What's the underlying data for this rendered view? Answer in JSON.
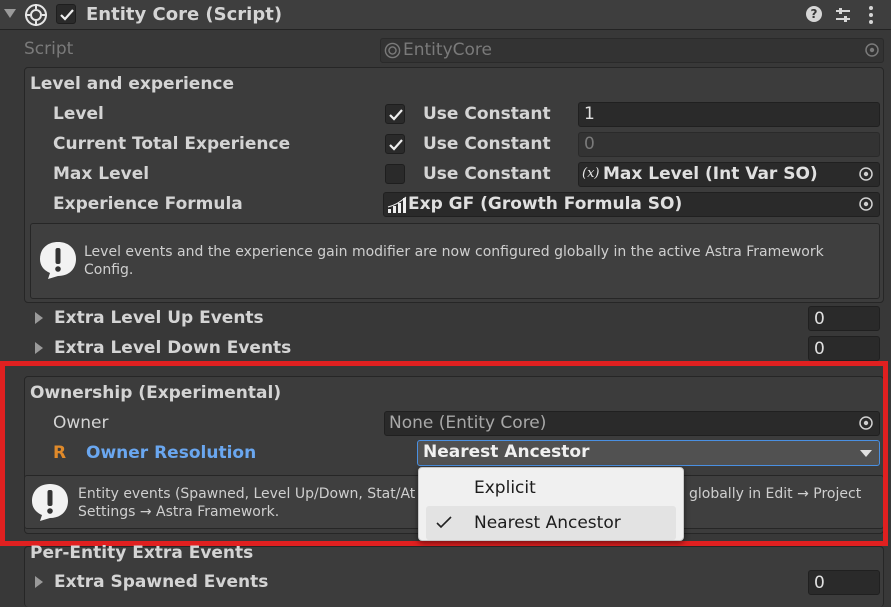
{
  "header": {
    "title": "Entity Core (Script)",
    "enabled": true
  },
  "script_row": {
    "label": "Script",
    "value": "EntityCore"
  },
  "level_section": {
    "title": "Level and experience",
    "rows": [
      {
        "label": "Level",
        "checked": true,
        "use_constant": "Use Constant",
        "value": "1"
      },
      {
        "label": "Current Total Experience",
        "checked": true,
        "use_constant": "Use Constant",
        "value": "0"
      },
      {
        "label": "Max Level",
        "checked": false,
        "use_constant": "Use Constant",
        "value": "Max Level (Int Var SO)"
      }
    ],
    "formula": {
      "label": "Experience Formula",
      "value": "Exp GF (Growth Formula SO)"
    },
    "help": "Level events and the experience gain modifier are now configured globally in the active Astra Framework Config.",
    "folds": [
      {
        "label": "Extra Level Up Events",
        "count": "0"
      },
      {
        "label": "Extra Level Down Events",
        "count": "0"
      }
    ]
  },
  "ownership_section": {
    "title": "Ownership (Experimental)",
    "owner_label": "Owner",
    "owner_value": "None (Entity Core)",
    "resolution_marker": "R",
    "resolution_label": "Owner Resolution",
    "resolution_value": "Nearest Ancestor",
    "help_left": "Entity events (Spawned, Level Up/Down, Stat/At",
    "help_right": "globally in Edit → Project",
    "help_line2": "Settings → Astra Framework."
  },
  "dropdown_menu": {
    "options": [
      {
        "label": "Explicit",
        "selected": false
      },
      {
        "label": "Nearest Ancestor",
        "selected": true
      }
    ]
  },
  "per_entity_section": {
    "title": "Per-Entity Extra Events",
    "fold_label": "Extra Spawned Events",
    "count": "0"
  },
  "colors": {
    "highlight_border": "#e02020",
    "accent_blue": "#6aa7f0",
    "marker_orange": "#e08a2a",
    "dropdown_focus": "#4a90e2"
  },
  "icons": [
    "fold-arrow-icon",
    "script-gear-icon",
    "checkbox-icon",
    "help-icon",
    "presets-icon",
    "kebab-icon",
    "object-picker-icon",
    "info-icon",
    "fx-icon",
    "growth-chart-icon",
    "dropdown-arrow-icon",
    "checkmark-icon"
  ]
}
